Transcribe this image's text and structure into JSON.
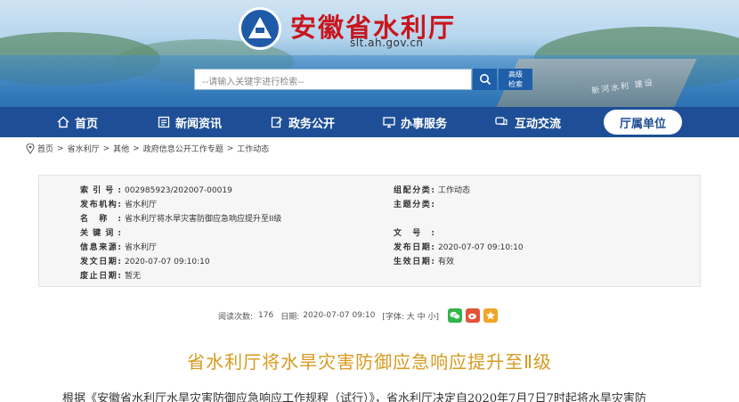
{
  "header": {
    "site_title": "安徽省水利厅",
    "site_domain": "slt.ah.gov.cn",
    "search_placeholder": "--请输入关键字进行检索--",
    "advanced_search_label": "高级检索",
    "dam_text": "新河水利 建设"
  },
  "nav": {
    "items": [
      {
        "label": "首页",
        "icon": "home-icon"
      },
      {
        "label": "新闻资讯",
        "icon": "news-icon"
      },
      {
        "label": "政务公开",
        "icon": "edit-icon"
      },
      {
        "label": "办事服务",
        "icon": "monitor-icon"
      },
      {
        "label": "互动交流",
        "icon": "chat-icon"
      },
      {
        "label": "厅属单位",
        "icon": ""
      }
    ],
    "active_index": 5
  },
  "breadcrumb": [
    "首页",
    "省水利厅",
    "其他",
    "政府信息公开工作专题",
    "工作动态"
  ],
  "info": {
    "left": [
      {
        "label": "索引号:",
        "value": "002985923/202007-00019"
      },
      {
        "label": "发布机构:",
        "value": "省水利厅"
      },
      {
        "label": "名称:",
        "value": "省水利厅将水旱灾害防御应急响应提升至II级"
      },
      {
        "label": "关键词:",
        "value": ""
      },
      {
        "label": "信息来源:",
        "value": "省水利厅"
      },
      {
        "label": "发文日期:",
        "value": "2020-07-07 09:10:10"
      },
      {
        "label": "废止日期:",
        "value": "暂无"
      }
    ],
    "right": [
      {
        "label": "组配分类:",
        "value": "工作动态"
      },
      {
        "label": "主题分类:",
        "value": ""
      },
      {
        "label": "文号:",
        "value": ""
      },
      {
        "label": "发布日期:",
        "value": "2020-07-07 09:10:10"
      },
      {
        "label": "生效日期:",
        "value": "有效"
      }
    ]
  },
  "meta": {
    "views_label": "阅读次数:",
    "views": "176",
    "date_label": "日期:",
    "date": "2020-07-07 09:10",
    "font_size_label": "[字体: 大 中 小]"
  },
  "article": {
    "title": "省水利厅将水旱灾害防御应急响应提升至Ⅱ级",
    "body_first_line": "根据《安徽省水利厅水旱灾害防御应急响应工作规程（试行）》，省水利厅决定自2020年7月7日7时起将水旱灾害防"
  },
  "colors": {
    "nav_bg": "#1e4f96",
    "title_red": "#c8161d",
    "article_title": "#d79a20",
    "wechat": "#2fb54a",
    "weibo": "#e3533a",
    "favorite": "#f2a42a"
  }
}
